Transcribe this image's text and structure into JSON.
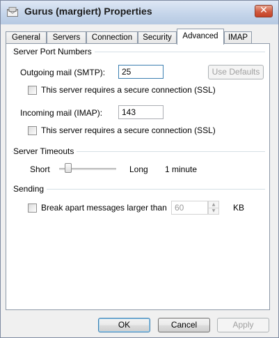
{
  "window": {
    "title": "Gurus (margiert) Properties",
    "close_glyph": "✕"
  },
  "tabs": [
    {
      "label": "General"
    },
    {
      "label": "Servers"
    },
    {
      "label": "Connection"
    },
    {
      "label": "Security"
    },
    {
      "label": "Advanced",
      "active": true
    },
    {
      "label": "IMAP"
    }
  ],
  "ports": {
    "group_label": "Server Port Numbers",
    "outgoing_label": "Outgoing mail (SMTP):",
    "outgoing_value": "25",
    "use_defaults_label": "Use Defaults",
    "smtp_ssl_label": "This server requires a secure connection (SSL)",
    "incoming_label": "Incoming mail (IMAP):",
    "incoming_value": "143",
    "imap_ssl_label": "This server requires a secure connection (SSL)"
  },
  "timeouts": {
    "group_label": "Server Timeouts",
    "short_label": "Short",
    "long_label": "Long",
    "value_label": "1 minute"
  },
  "sending": {
    "group_label": "Sending",
    "break_label": "Break apart messages larger than",
    "size_value": "60",
    "unit_label": "KB"
  },
  "footer": {
    "ok_label": "OK",
    "cancel_label": "Cancel",
    "apply_label": "Apply"
  }
}
